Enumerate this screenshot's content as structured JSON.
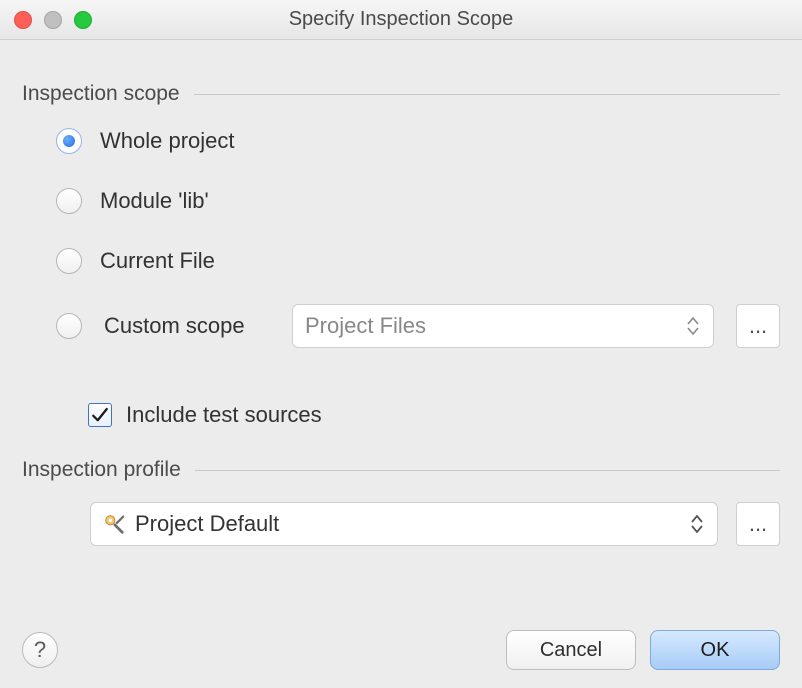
{
  "window": {
    "title": "Specify Inspection Scope"
  },
  "scope": {
    "heading": "Inspection scope",
    "options": {
      "whole": "Whole project",
      "module": "Module 'lib'",
      "current": "Current File",
      "custom": "Custom scope"
    },
    "selected": "whole",
    "customDropdownValue": "Project Files",
    "dotsLabel": "...",
    "includeTestsLabel": "Include test sources",
    "includeTestsChecked": true
  },
  "profile": {
    "heading": "Inspection profile",
    "value": "Project Default",
    "dotsLabel": "..."
  },
  "footer": {
    "helpTooltip": "?",
    "cancel": "Cancel",
    "ok": "OK"
  }
}
